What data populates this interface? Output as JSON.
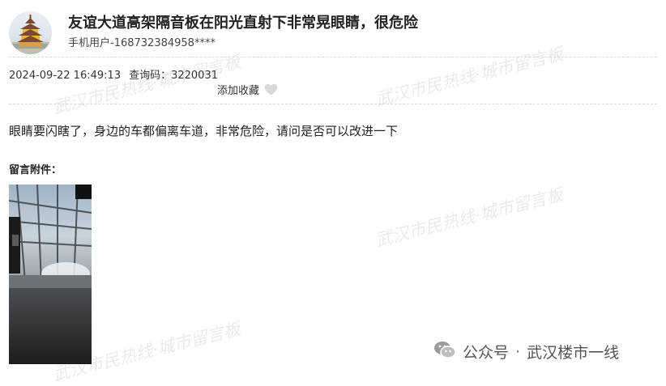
{
  "post": {
    "title": "友谊大道高架隔音板在阳光直射下非常晃眼睛，很危险",
    "author": "手机用户-168732384958****",
    "datetime": "2024-09-22 16:49:13",
    "query_code_label": "查询码：",
    "query_code": "3220031",
    "favorite_label": "添加收藏",
    "content": "眼睛要闪瞎了，身边的车都偏离车道，非常危险，请问是否可以改进一下",
    "attachment_label": "留言附件："
  },
  "watermark": {
    "text": "武汉市民热线·城市留言板"
  },
  "branding": {
    "channel": "公众号",
    "separator": "·",
    "name": "武汉楼市一线",
    "prefix": "公众号"
  },
  "icons": {
    "favorite": "heart-icon",
    "channel": "wechat-icon"
  },
  "colors": {
    "heart": "#d8d8d8",
    "title": "#222222"
  }
}
